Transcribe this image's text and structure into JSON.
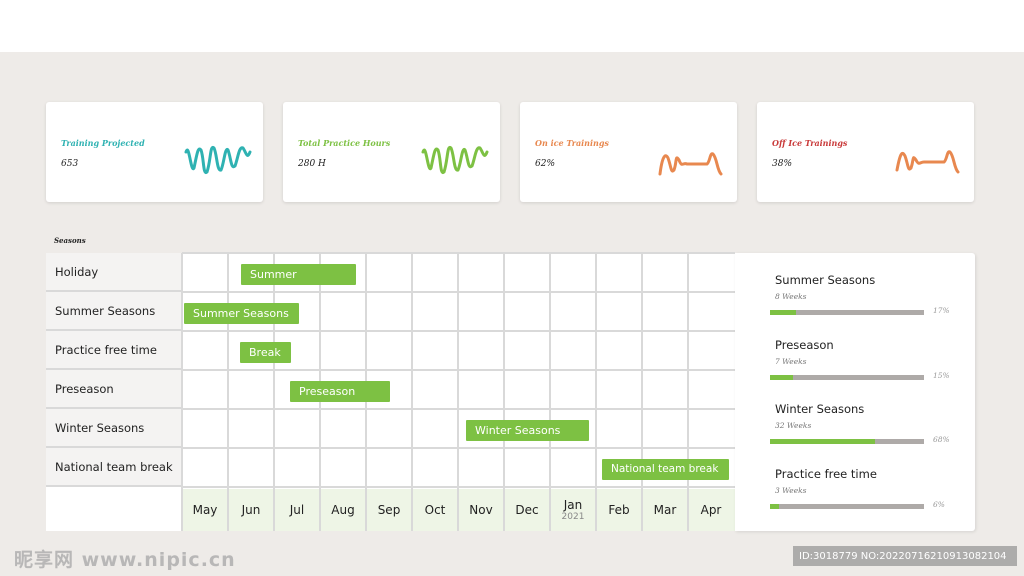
{
  "cards": [
    {
      "title": "Training Projected",
      "value": "653",
      "color": "#2fb2b2",
      "icon": "wave-icon"
    },
    {
      "title": "Total Practice Hours",
      "value": "280 H",
      "color": "#7dc143",
      "icon": "wave-icon"
    },
    {
      "title": "On ice Trainings",
      "value": "62%",
      "color": "#e8884f",
      "icon": "pulse-icon"
    },
    {
      "title": "Off Ice Trainings",
      "value": "38%",
      "color": "#e8884f",
      "icon": "pulse-icon"
    }
  ],
  "card_title_colors": [
    "#2fb2b2",
    "#7dc143",
    "#e8884f",
    "#c93a3a"
  ],
  "seasons_label": "Seasons",
  "rows": [
    "Holiday",
    "Summer Seasons",
    "Practice free time",
    "Preseason",
    "Winter Seasons",
    "National team break"
  ],
  "months": [
    "May",
    "Jun",
    "Jul",
    "Aug",
    "Sep",
    "Oct",
    "Nov",
    "Dec",
    "Jan",
    "Feb",
    "Mar",
    "Apr"
  ],
  "year_label": "2021",
  "bars": [
    {
      "label": "Summer"
    },
    {
      "label": "Summer Seasons"
    },
    {
      "label": "Break"
    },
    {
      "label": "Preseason"
    },
    {
      "label": "Winter Seasons"
    },
    {
      "label": "National team break"
    }
  ],
  "summary": [
    {
      "title": "Summer Seasons",
      "weeks": "8 Weeks",
      "pct_label": "17%",
      "pct": 17
    },
    {
      "title": "Preseason",
      "weeks": "7 Weeks",
      "pct_label": "15%",
      "pct": 15
    },
    {
      "title": "Winter Seasons",
      "weeks": "32 Weeks",
      "pct_label": "68%",
      "pct": 68
    },
    {
      "title": "Practice free time",
      "weeks": "3 Weeks",
      "pct_label": "6%",
      "pct": 6
    }
  ],
  "accent": "#7dc143",
  "watermark": "昵享网 www.nipic.cn",
  "image_id": "ID:3018779 NO:20220716210913082104"
}
